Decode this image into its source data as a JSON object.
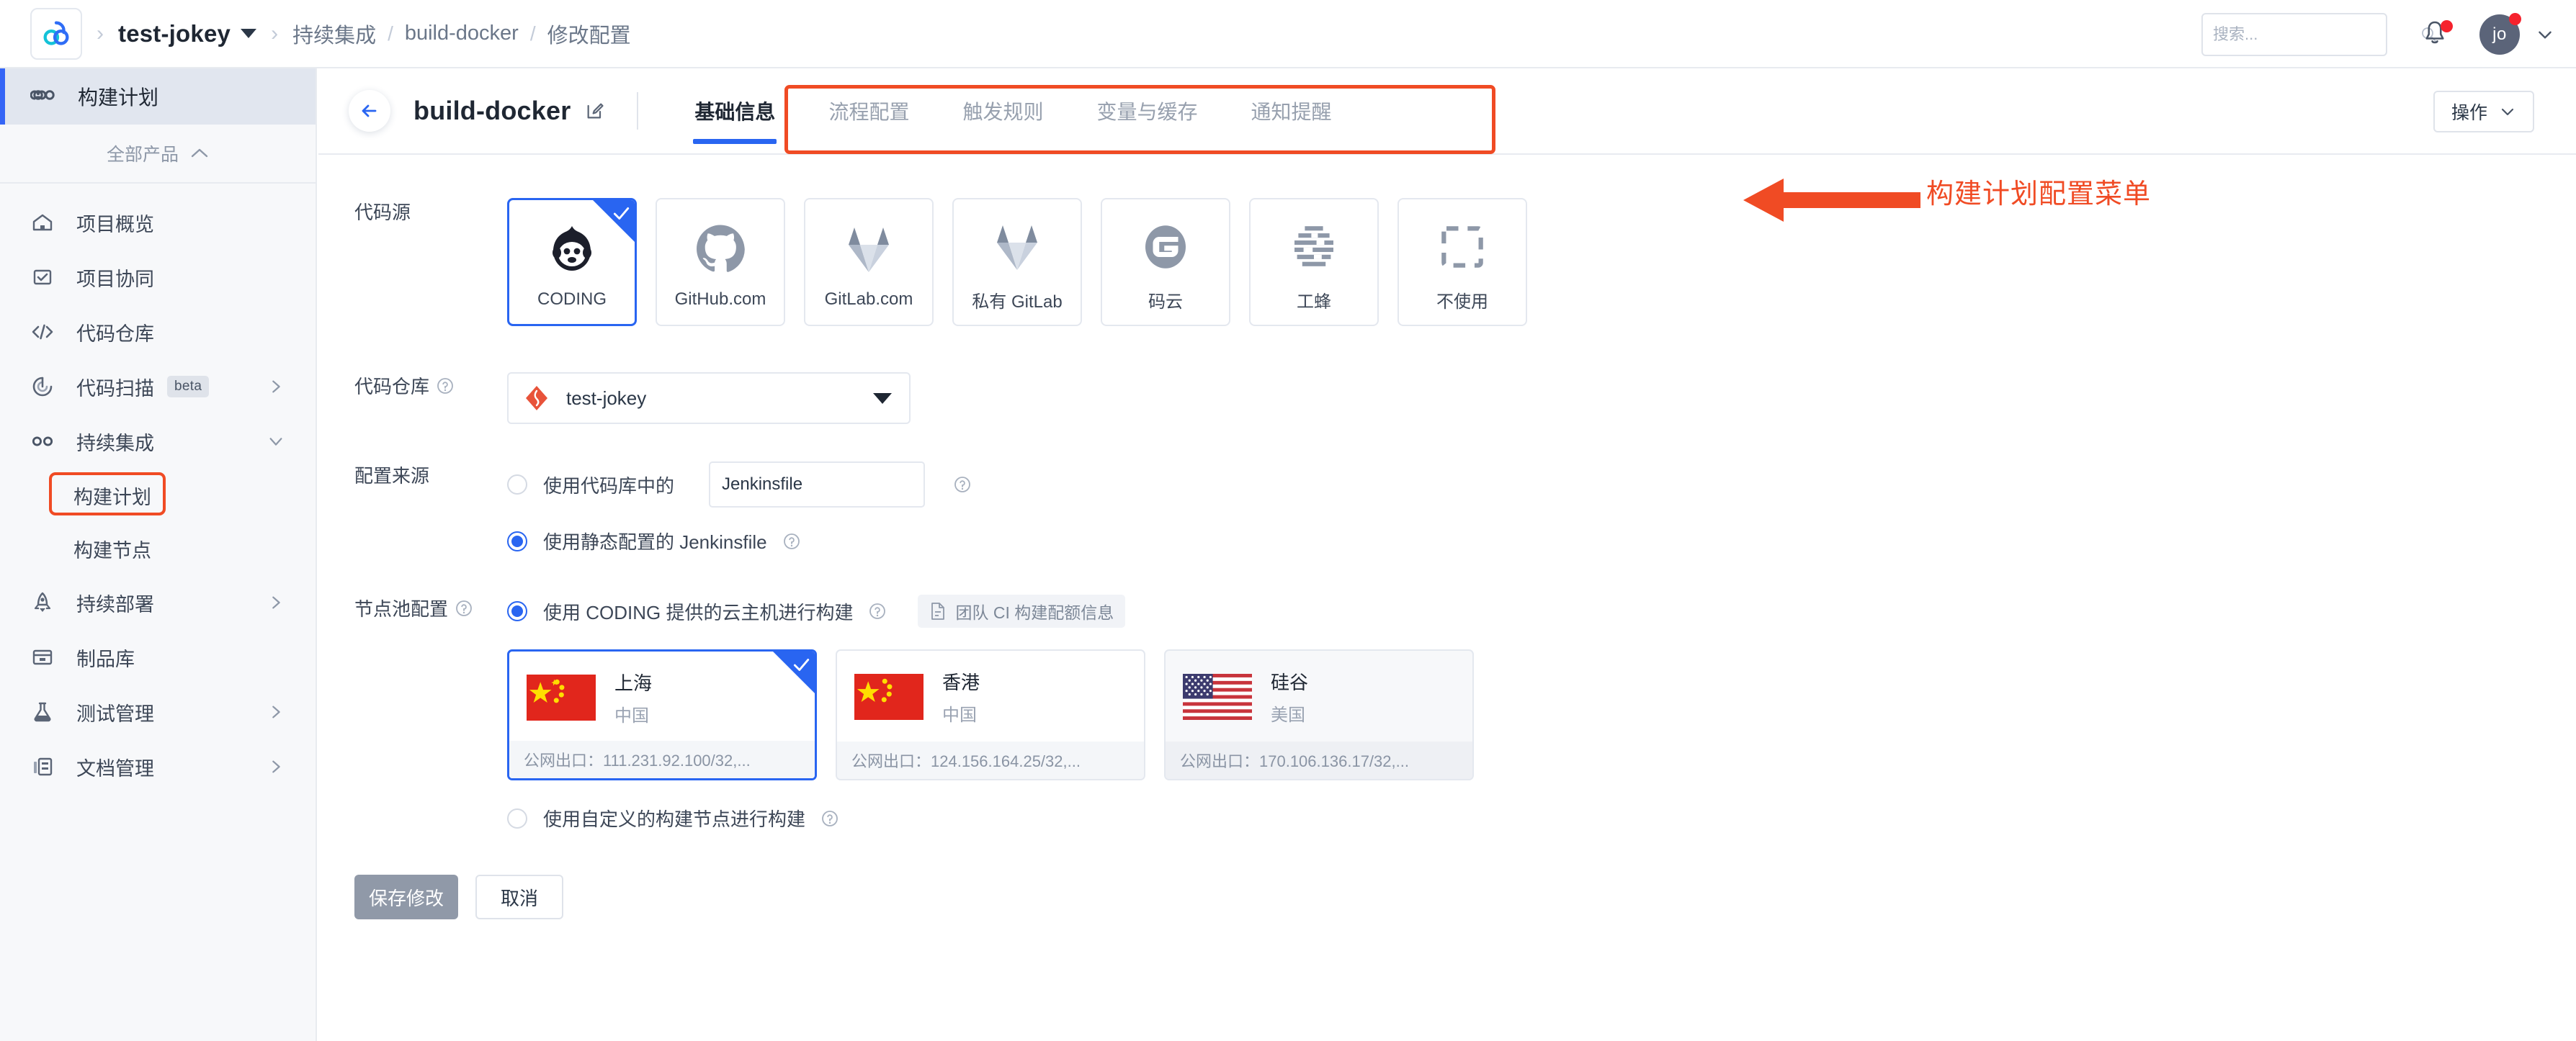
{
  "topbar": {
    "logo": "coding-cloud-logo",
    "project_name": "test-jokey",
    "breadcrumb": [
      "持续集成",
      "build-docker",
      "修改配置"
    ],
    "search_placeholder": "搜索...",
    "search_value": "",
    "avatar_initials": "jo"
  },
  "sidebar": {
    "active_top": {
      "label": "构建计划",
      "icon": "infinity-icon"
    },
    "all_products_label": "全部产品",
    "items": [
      {
        "label": "项目概览",
        "icon": "home-icon",
        "expandable": false,
        "badge": ""
      },
      {
        "label": "项目协同",
        "icon": "checkbox-icon",
        "expandable": false,
        "badge": ""
      },
      {
        "label": "代码仓库",
        "icon": "code-icon",
        "expandable": false,
        "badge": ""
      },
      {
        "label": "代码扫描",
        "icon": "scan-icon",
        "expandable": true,
        "badge": "beta"
      },
      {
        "label": "持续集成",
        "icon": "infinity-icon",
        "expandable": true,
        "expanded": true,
        "badge": ""
      }
    ],
    "sub_items": [
      {
        "label": "构建计划",
        "highlighted": true
      },
      {
        "label": "构建节点",
        "highlighted": false
      }
    ],
    "items_after": [
      {
        "label": "持续部署",
        "icon": "rocket-icon",
        "expandable": true,
        "badge": ""
      },
      {
        "label": "制品库",
        "icon": "archive-icon",
        "expandable": false,
        "badge": ""
      },
      {
        "label": "测试管理",
        "icon": "flask-icon",
        "expandable": true,
        "badge": ""
      },
      {
        "label": "文档管理",
        "icon": "doc-icon",
        "expandable": true,
        "badge": ""
      }
    ]
  },
  "main": {
    "back_icon": "arrow-left-icon",
    "plan_title": "build-docker",
    "edit_icon": "edit-icon",
    "tabs": [
      {
        "label": "基础信息",
        "active": true
      },
      {
        "label": "流程配置",
        "active": false
      },
      {
        "label": "触发规则",
        "active": false
      },
      {
        "label": "变量与缓存",
        "active": false
      },
      {
        "label": "通知提醒",
        "active": false
      }
    ],
    "annotation_text": "构建计划配置菜单",
    "annotation_color": "#f04b24",
    "action_button": "操作"
  },
  "form": {
    "code_source": {
      "label": "代码源",
      "cards": [
        {
          "name": "CODING",
          "icon": "coding-monkey-icon",
          "selected": true
        },
        {
          "name": "GitHub.com",
          "icon": "github-icon",
          "selected": false
        },
        {
          "name": "GitLab.com",
          "icon": "gitlab-icon",
          "selected": false
        },
        {
          "name": "私有 GitLab",
          "icon": "gitlab-icon",
          "selected": false
        },
        {
          "name": "码云",
          "icon": "gitee-icon",
          "selected": false
        },
        {
          "name": "工蜂",
          "icon": "tencent-gongfeng-icon",
          "selected": false
        },
        {
          "name": "不使用",
          "icon": "dashed-square-icon",
          "selected": false
        }
      ]
    },
    "repository": {
      "label": "代码仓库",
      "has_help": true,
      "selected_value": "test-jokey",
      "repo_icon": "git-repo-icon"
    },
    "config_source": {
      "label": "配置来源",
      "option1_text": "使用代码库中的",
      "option1_selected": false,
      "jenkinsfile_value": "Jenkinsfile",
      "jenkinsfile_placeholder": "Jenkinsfile",
      "option2_text": "使用静态配置的 Jenkinsfile",
      "option2_selected": true
    },
    "node_pool": {
      "label": "节点池配置",
      "has_help": true,
      "cloud_option_text": "使用 CODING 提供的云主机进行构建",
      "cloud_option_selected": true,
      "quota_link_text": "团队 CI 构建配额信息",
      "quota_icon": "document-icon",
      "nodes": [
        {
          "city": "上海",
          "country": "中国",
          "flag": "cn",
          "egress": "公网出口：111.231.92.100/32,...",
          "selected": true,
          "dimmed": false
        },
        {
          "city": "香港",
          "country": "中国",
          "flag": "cn",
          "egress": "公网出口：124.156.164.25/32,...",
          "selected": false,
          "dimmed": false
        },
        {
          "city": "硅谷",
          "country": "美国",
          "flag": "us",
          "egress": "公网出口：170.106.136.17/32,...",
          "selected": false,
          "dimmed": true
        }
      ],
      "custom_option_text": "使用自定义的构建节点进行构建",
      "custom_option_selected": false
    },
    "buttons": {
      "save": "保存修改",
      "cancel": "取消"
    }
  },
  "colors": {
    "accent_blue": "#2965f1",
    "annotation_red": "#f04b24",
    "sidebar_bg": "#f7f8fa",
    "text_primary": "#1f2733",
    "text_muted": "#97a0ae"
  }
}
